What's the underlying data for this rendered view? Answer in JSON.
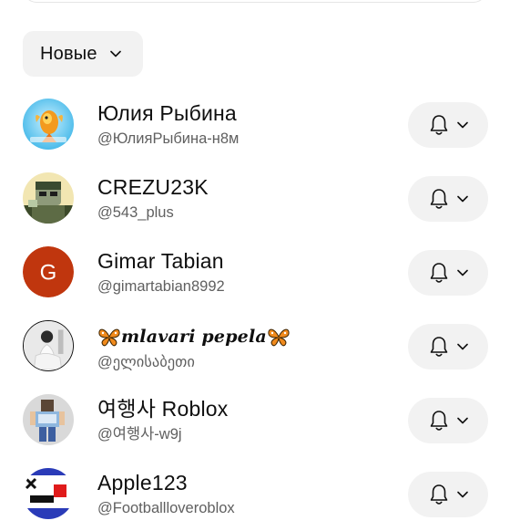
{
  "sort": {
    "label": "Новые"
  },
  "subscriptions": [
    {
      "name": "Юлия Рыбина",
      "handle": "@ЮлияРыбина-н8м",
      "avatar": "goldfish-avatar",
      "bell_icon": "bell-icon"
    },
    {
      "name": "CREZU23K",
      "handle": "@543_plus",
      "avatar": "character-avatar",
      "bell_icon": "bell-icon"
    },
    {
      "name": "Gimar Tabian",
      "handle": "@gimartabian8992",
      "avatar": "letter-avatar",
      "avatar_letter": "G",
      "avatar_color": "#c0360e",
      "bell_icon": "bell-icon"
    },
    {
      "name": "mlavari pepela",
      "handle": "@ელისაბეთი",
      "avatar": "photo-avatar",
      "bell_icon": "bell-icon"
    },
    {
      "name": "여행사 Roblox",
      "handle": "@여행사-w9j",
      "avatar": "roblox-avatar",
      "bell_icon": "bell-icon"
    },
    {
      "name": "Apple123",
      "handle": "@Footballloveroblox",
      "avatar": "logo-avatar",
      "bell_icon": "bell-icon"
    }
  ]
}
